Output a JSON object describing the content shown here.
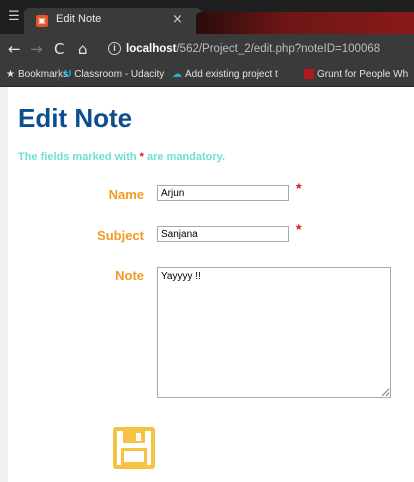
{
  "browser": {
    "tab_title": "Edit Note",
    "tab_close": "×",
    "url_host": "localhost",
    "url_path": "/562/Project_2/edit.php?noteID=100068",
    "bookmarks": [
      {
        "label": "Bookmarks",
        "icon": "star-icon"
      },
      {
        "label": "Classroom - Udacity",
        "icon": "udacity-icon"
      },
      {
        "label": "Add existing project t",
        "icon": "cloud-icon"
      },
      {
        "label": "Grunt for People Wh",
        "icon": "grunt-icon"
      }
    ]
  },
  "page": {
    "title": "Edit Note",
    "mandatory_prefix": "The fields marked with ",
    "mandatory_star": "*",
    "mandatory_suffix": " are mandatory."
  },
  "form": {
    "name_label": "Name",
    "name_value": "Arjun",
    "subject_label": "Subject",
    "subject_value": "Sanjana",
    "note_label": "Note",
    "note_value": "Yayyyy !!",
    "required_marker": "*"
  },
  "colors": {
    "title": "#0d4f8c",
    "labels": "#f59a23",
    "mandatory_text": "#6fe0d0",
    "required_star": "#e01414",
    "save_icon": "#f5c242"
  }
}
